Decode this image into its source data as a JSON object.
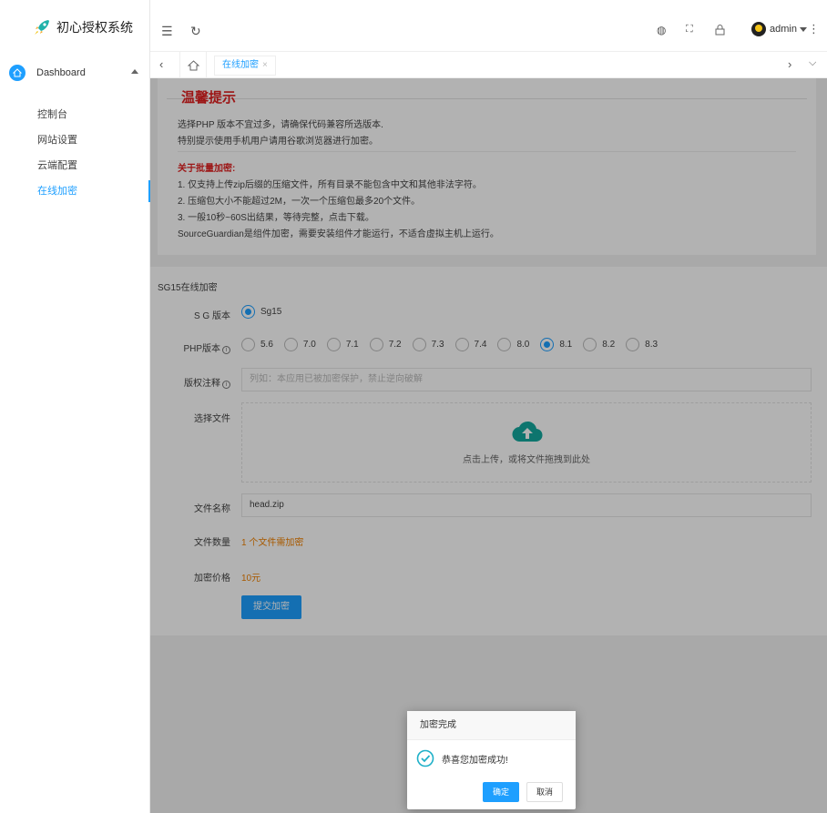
{
  "app": {
    "title": "初心授权系统"
  },
  "sidebar": {
    "parent": "Dashboard",
    "items": [
      {
        "label": "控制台"
      },
      {
        "label": "网站设置"
      },
      {
        "label": "云端配置"
      },
      {
        "label": "在线加密",
        "active": true
      }
    ]
  },
  "header": {
    "username": "admin",
    "icons": [
      "menu-fold-icon",
      "refresh-icon",
      "globe-icon",
      "fullscreen-icon",
      "lock-icon",
      "more-icon"
    ]
  },
  "tabs": {
    "current": "在线加密",
    "close": "×"
  },
  "notice": {
    "title": "温馨提示",
    "line1": "选择PHP 版本不宜过多，请确保代码兼容所选版本.",
    "line2": "特别提示使用手机用户请用谷歌浏览器进行加密。",
    "batch_title": "关于批量加密:",
    "batch1": "1. 仅支持上传zip后缀的压缩文件，所有目录不能包含中文和其他非法字符。",
    "batch2": "2. 压缩包大小不能超过2M，一次一个压缩包最多20个文件。",
    "batch3": "3. 一般10秒~60S出结果，等待完整，点击下载。",
    "batch4": "SourceGuardian是组件加密，需要安装组件才能运行，不适合虚拟主机上运行。"
  },
  "form": {
    "card_title": "SG15在线加密",
    "sg_label": "S G 版本",
    "sg_option": "Sg15",
    "php_label": "PHP版本",
    "php_versions": [
      "5.6",
      "7.0",
      "7.1",
      "7.2",
      "7.3",
      "7.4",
      "8.0",
      "8.1",
      "8.2",
      "8.3"
    ],
    "php_selected": "8.1",
    "copyright_label": "版权注释",
    "copyright_placeholder": "列如：本应用已被加密保护，禁止逆向破解",
    "file_label": "选择文件",
    "upload_text": "点击上传，或将文件拖拽到此处",
    "filename_label": "文件名称",
    "filename_value": "head.zip",
    "count_label": "文件数量",
    "count_value": "1 个文件需加密",
    "price_label": "加密价格",
    "price_value": "10元",
    "submit_label": "提交加密"
  },
  "dialog": {
    "title": "加密完成",
    "message": "恭喜您加密成功!",
    "confirm": "确定",
    "cancel": "取消"
  },
  "colors": {
    "accent": "#1e9fff",
    "danger": "#e02020",
    "warning": "#f08000",
    "upload_icon": "#13a89e"
  }
}
